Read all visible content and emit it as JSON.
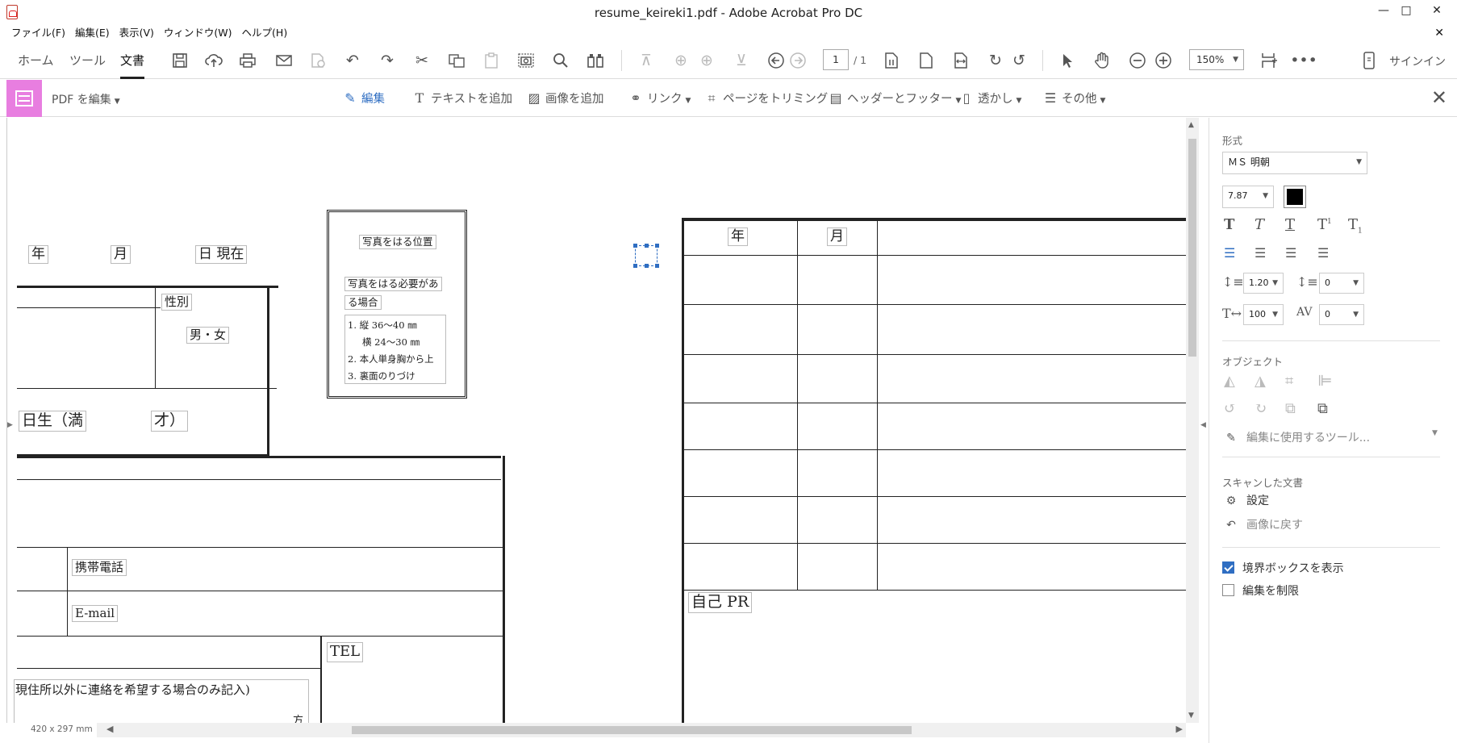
{
  "window": {
    "title": "resume_keireki1.pdf - Adobe Acrobat Pro DC",
    "minimize": "—",
    "maximize": "□",
    "close": "✕"
  },
  "menu": {
    "items": [
      "ファイル(F)",
      "編集(E)",
      "表示(V)",
      "ウィンドウ(W)",
      "ヘルプ(H)"
    ],
    "close": "✕"
  },
  "toolbar": {
    "tabs": [
      "ホーム",
      "ツール",
      "文書"
    ],
    "active_tab": "文書",
    "page_current": "1",
    "page_total": "/ 1",
    "zoom": "150%",
    "more": "•••",
    "signin": "サインイン"
  },
  "edit_toolbar": {
    "mode_label": "PDF を編集",
    "tools": [
      {
        "label": "編集",
        "active": true
      },
      {
        "label": "テキストを追加"
      },
      {
        "label": "画像を追加"
      },
      {
        "label": "リンク",
        "dropdown": true
      },
      {
        "label": "ページをトリミング"
      },
      {
        "label": "ヘッダーとフッター",
        "dropdown": true
      },
      {
        "label": "透かし",
        "dropdown": true
      },
      {
        "label": "その他",
        "dropdown": true
      }
    ],
    "close": "✕"
  },
  "document": {
    "date_line": {
      "year": "年",
      "month": "月",
      "day": "日 現在"
    },
    "gender_label": "性別",
    "gender_value": "男・女",
    "birth_suffix": "日生（満",
    "age_suffix": "才）",
    "photo": {
      "title": "写真をはる位置",
      "need_line1": "写真をはる必要があ",
      "need_line2": "る場合",
      "rules": [
        "1. 縦 36〜40 ㎜",
        "横 24〜30 ㎜",
        "2. 本人単身胸から上",
        "3. 裏面のりづけ"
      ]
    },
    "mobile": "携帯電話",
    "email": "E-mail",
    "tel": "TEL",
    "contact_note": "現住所以外に連絡を希望する場合のみ記入)",
    "contact_kata": "方",
    "history_header": {
      "year": "年",
      "month": "月"
    },
    "self_pr": "自己 PR",
    "page_size": "420 x 297 mm"
  },
  "right_panel": {
    "format_label": "形式",
    "font": "ＭＳ 明朝",
    "font_size": "7.87",
    "text_color": "#000000",
    "line_spacing": "1.20",
    "para_spacing": "0",
    "h_scale": "100",
    "char_spacing": "0",
    "object_label": "オブジェクト",
    "edit_tool_label": "編集に使用するツール...",
    "scanned_label": "スキャンした文書",
    "settings_label": "設定",
    "revert_label": "画像に戻す",
    "show_bbox_label": "境界ボックスを表示",
    "show_bbox": true,
    "restrict_label": "編集を制限",
    "restrict": false
  }
}
